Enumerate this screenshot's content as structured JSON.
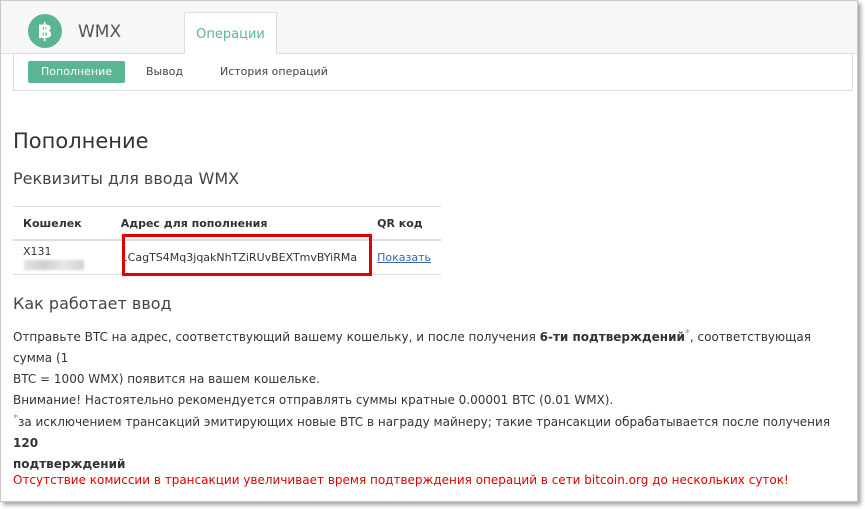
{
  "app": {
    "logo_symbol": "฿",
    "title": "WMX"
  },
  "tabs": [
    {
      "label": "Операции",
      "active": true
    }
  ],
  "subnav": [
    {
      "label": "Пополнение",
      "active": true
    },
    {
      "label": "Вывод",
      "active": false
    },
    {
      "label": "История операций",
      "active": false
    }
  ],
  "page_title": "Пополнение",
  "requisites_title": "Реквизиты для ввода WMX",
  "table": {
    "headers": [
      "Кошелек",
      "Адрес для пополнения",
      "QR код"
    ],
    "rows": [
      {
        "wallet": "X131",
        "address": "1CagTS4Mq3jqakNhTZiRUvBEXTmvBYiRMa",
        "qr": "Показать"
      }
    ]
  },
  "how_title": "Как работает ввод",
  "how": {
    "line1_a": "Отправьте BTC на адрес, соответствующий вашему кошельку, и после получения ",
    "line1_b": "6-ти подтверждений",
    "line1_c": ", соответствующая сумма (1",
    "line2": "BTC = 1000 WMX) появится на вашем кошельке.",
    "line3": "Внимание! Настоятельно рекомендуется отправлять суммы кратные 0.00001 BTC (0.01 WMX).",
    "asterisk": "*"
  },
  "footnote": {
    "text": "за исключением трансакций эмитирующих новые BTC в награду майнеру; такие трансакции обрабатывается после получения ",
    "bold_1": "120",
    "bold_2": "подтверждений"
  },
  "warning": "Отсутствие комиссии в трансакции увеличивает время подтверждения операций в сети bitcoin.org до нескольких суток!",
  "colors": {
    "accent": "#5cb592",
    "warning": "#e00000",
    "link": "#3366aa"
  }
}
